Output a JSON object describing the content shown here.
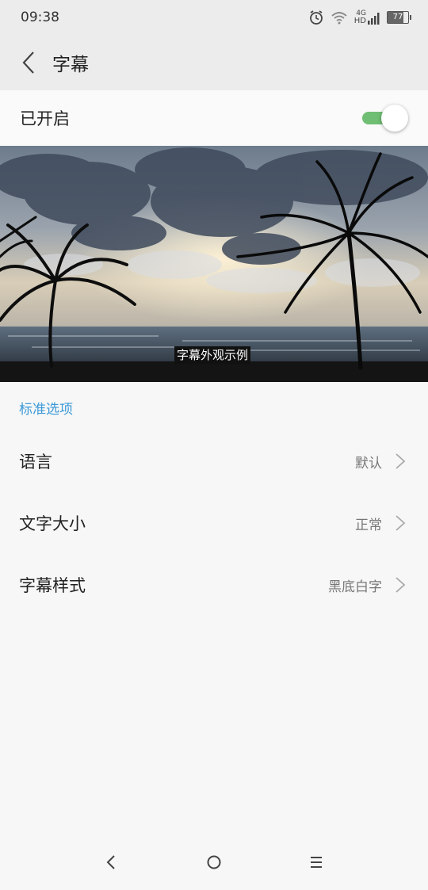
{
  "status_bar": {
    "time": "09:38",
    "network_label": "4G",
    "hd_label": "HD",
    "battery_level": "77",
    "icons": [
      "alarm-icon",
      "wifi-icon",
      "signal-icon",
      "battery-icon"
    ]
  },
  "header": {
    "title": "字幕",
    "back_icon": "back-arrow-icon"
  },
  "toggle": {
    "label": "已开启",
    "on": true,
    "accent": "#6fbe73"
  },
  "preview": {
    "caption": "字幕外观示例"
  },
  "section": {
    "title": "标准选项",
    "color": "#3d9ad8"
  },
  "settings": [
    {
      "label": "语言",
      "value": "默认"
    },
    {
      "label": "文字大小",
      "value": "正常"
    },
    {
      "label": "字幕样式",
      "value": "黑底白字"
    }
  ],
  "nav_bar": {
    "icons": [
      "nav-back-icon",
      "nav-home-icon",
      "nav-menu-icon"
    ]
  }
}
